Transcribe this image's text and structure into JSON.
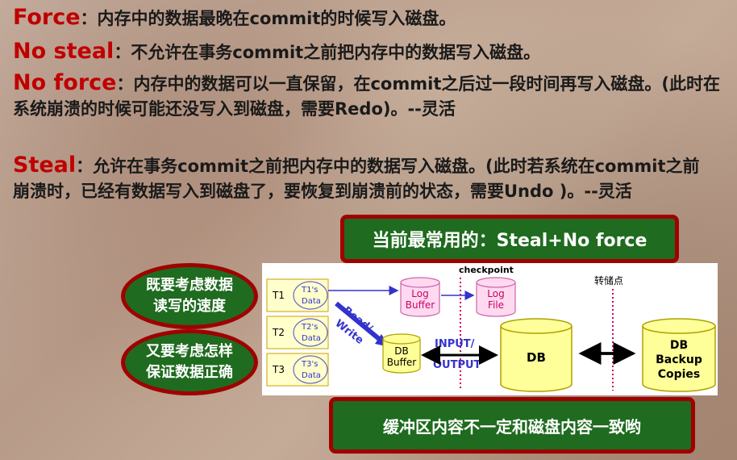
{
  "definitions": [
    {
      "term": "Force",
      "text": "：内存中的数据最晚在commit的时候写入磁盘。"
    },
    {
      "term": "No steal",
      "text": "：不允许在事务commit之前把内存中的数据写入磁盘。"
    },
    {
      "term": "No force",
      "text": "：内存中的数据可以一直保留，在commit之后过一段时间再写入磁盘。(此时在系统崩溃的时候可能还没写入到磁盘，需要Redo)。--灵活"
    },
    {
      "term": "Steal",
      "text": "：允许在事务commit之前把内存中的数据写入磁盘。(此时若系统在commit之前崩溃时，已经有数据写入到磁盘了，要恢复到崩溃前的状态，需要Undo )。--灵活"
    }
  ],
  "callouts": {
    "most_common": "当前最常用的：Steal+No force",
    "speed_line1": "既要考虑数据",
    "speed_line2": "读写的速度",
    "correct_line1": "又要考虑怎样",
    "correct_line2": "保证数据正确",
    "buffer_note": "缓冲区内容不一定和磁盘内容一致哟"
  },
  "diagram": {
    "checkpoint": "checkpoint",
    "transfer_point": "转储点",
    "transactions": [
      {
        "id": "T1",
        "data_line1": "T1's",
        "data_line2": "Data"
      },
      {
        "id": "T2",
        "data_line1": "T2's",
        "data_line2": "Data"
      },
      {
        "id": "T3",
        "data_line1": "T3's",
        "data_line2": "Data"
      }
    ],
    "log_buffer_line1": "Log",
    "log_buffer_line2": "Buffer",
    "log_file_line1": "Log",
    "log_file_line2": "File",
    "read_label": "Read/",
    "write_label": "Write",
    "db_buffer_line1": "DB",
    "db_buffer_line2": "Buffer",
    "input_label": "INPUT/",
    "output_label": "OUTPUT",
    "db": "DB",
    "backup_line1": "DB",
    "backup_line2": "Backup",
    "backup_line3": "Copies"
  },
  "colors": {
    "term": "#c00000",
    "pill_fill": "#1f6b1f",
    "pill_border": "#a00000",
    "cylinder_fill": "#ffff99",
    "arrow_blue": "#3333cc",
    "checkpoint_line": "#cc0066"
  }
}
